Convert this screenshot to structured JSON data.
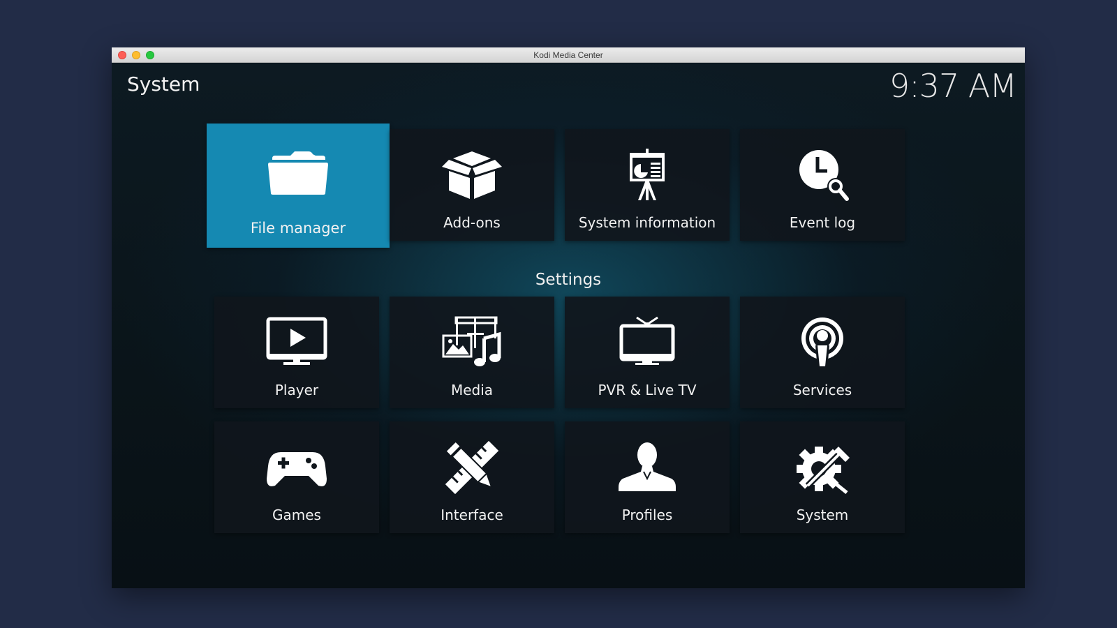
{
  "window": {
    "title": "Kodi Media Center"
  },
  "header": {
    "title": "System",
    "clock": "9:37 AM"
  },
  "top_row": [
    {
      "label": "File manager",
      "icon": "folder-icon",
      "focused": true
    },
    {
      "label": "Add-ons",
      "icon": "box-icon"
    },
    {
      "label": "System information",
      "icon": "presentation-icon"
    },
    {
      "label": "Event log",
      "icon": "clock-search-icon"
    }
  ],
  "settings": {
    "heading": "Settings",
    "items": [
      {
        "label": "Player",
        "icon": "monitor-play-icon"
      },
      {
        "label": "Media",
        "icon": "media-icon"
      },
      {
        "label": "PVR & Live TV",
        "icon": "tv-icon"
      },
      {
        "label": "Services",
        "icon": "broadcast-icon"
      },
      {
        "label": "Games",
        "icon": "gamepad-icon"
      },
      {
        "label": "Interface",
        "icon": "pencil-ruler-icon"
      },
      {
        "label": "Profiles",
        "icon": "user-icon"
      },
      {
        "label": "System",
        "icon": "gear-tools-icon"
      }
    ]
  },
  "colors": {
    "focus": "#1589b2",
    "tile": "#10161c",
    "desktop": "#222c47"
  }
}
